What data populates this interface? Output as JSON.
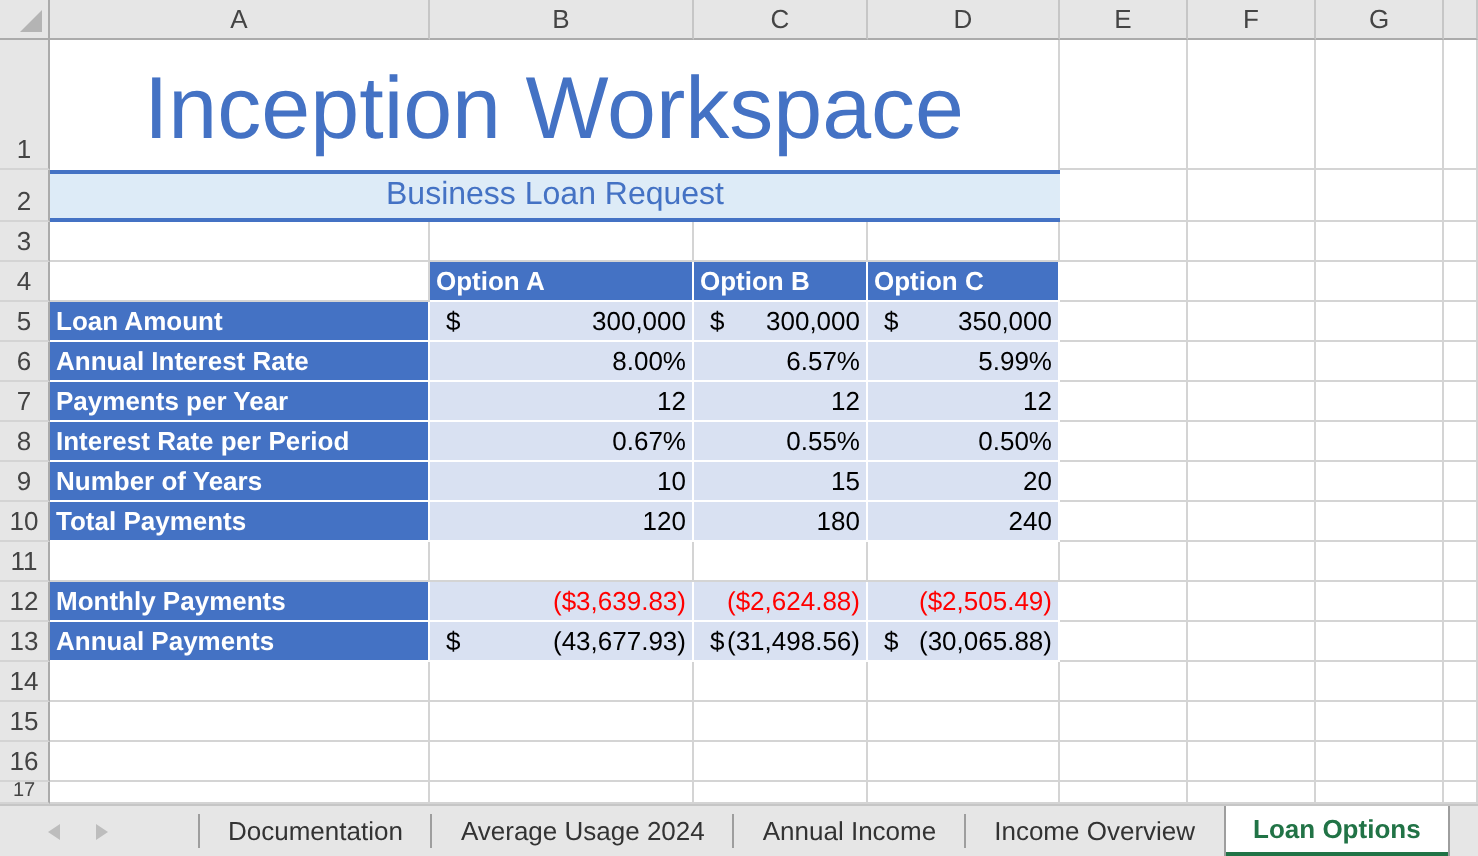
{
  "columns": [
    "A",
    "B",
    "C",
    "D",
    "E",
    "F",
    "G"
  ],
  "rows": [
    {
      "number": "1",
      "cells": [
        {
          "kind": "title",
          "text": "Inception Workspace"
        }
      ]
    },
    {
      "number": "2",
      "cells": [
        {
          "kind": "subtitle",
          "text": "Business Loan Request"
        }
      ]
    },
    {
      "number": "3",
      "cells": []
    },
    {
      "number": "4",
      "cells": [
        {
          "kind": "empty"
        },
        {
          "kind": "header",
          "text": "Option A"
        },
        {
          "kind": "header",
          "text": "Option B"
        },
        {
          "kind": "header",
          "text": "Option C"
        }
      ]
    },
    {
      "number": "5",
      "cells": [
        {
          "kind": "label",
          "text": "Loan Amount"
        },
        {
          "kind": "value",
          "symbol": "$",
          "text": "300,000",
          "red": false
        },
        {
          "kind": "value",
          "symbol": "$",
          "text": "300,000",
          "red": false
        },
        {
          "kind": "value",
          "symbol": "$",
          "text": "350,000",
          "red": false
        }
      ]
    },
    {
      "number": "6",
      "cells": [
        {
          "kind": "label",
          "text": "Annual Interest Rate"
        },
        {
          "kind": "value",
          "text": "8.00%",
          "red": false
        },
        {
          "kind": "value",
          "text": "6.57%",
          "red": false
        },
        {
          "kind": "value",
          "text": "5.99%",
          "red": false
        }
      ]
    },
    {
      "number": "7",
      "cells": [
        {
          "kind": "label",
          "text": "Payments per Year"
        },
        {
          "kind": "value",
          "text": "12",
          "red": false
        },
        {
          "kind": "value",
          "text": "12",
          "red": false
        },
        {
          "kind": "value",
          "text": "12",
          "red": false
        }
      ]
    },
    {
      "number": "8",
      "cells": [
        {
          "kind": "label",
          "text": "Interest Rate per Period"
        },
        {
          "kind": "value",
          "text": "0.67%",
          "red": false
        },
        {
          "kind": "value",
          "text": "0.55%",
          "red": false
        },
        {
          "kind": "value",
          "text": "0.50%",
          "red": false
        }
      ]
    },
    {
      "number": "9",
      "cells": [
        {
          "kind": "label",
          "text": "Number of Years"
        },
        {
          "kind": "value",
          "text": "10",
          "red": false
        },
        {
          "kind": "value",
          "text": "15",
          "red": false
        },
        {
          "kind": "value",
          "text": "20",
          "red": false
        }
      ]
    },
    {
      "number": "10",
      "cells": [
        {
          "kind": "label",
          "text": "Total Payments"
        },
        {
          "kind": "value",
          "text": "120",
          "red": false
        },
        {
          "kind": "value",
          "text": "180",
          "red": false
        },
        {
          "kind": "value",
          "text": "240",
          "red": false
        }
      ]
    },
    {
      "number": "11",
      "cells": []
    },
    {
      "number": "12",
      "cells": [
        {
          "kind": "label",
          "text": "Monthly Payments"
        },
        {
          "kind": "value",
          "text": "($3,639.83)",
          "red": true
        },
        {
          "kind": "value",
          "text": "($2,624.88)",
          "red": true
        },
        {
          "kind": "value",
          "text": "($2,505.49)",
          "red": true
        }
      ]
    },
    {
      "number": "13",
      "cells": [
        {
          "kind": "label",
          "text": "Annual Payments"
        },
        {
          "kind": "value",
          "symbol": "$",
          "text": "(43,677.93)",
          "red": false
        },
        {
          "kind": "value",
          "symbol": "$",
          "text": "(31,498.56)",
          "red": false
        },
        {
          "kind": "value",
          "symbol": "$",
          "text": "(30,065.88)",
          "red": false
        }
      ]
    },
    {
      "number": "14",
      "cells": []
    },
    {
      "number": "15",
      "cells": []
    },
    {
      "number": "16",
      "cells": []
    },
    {
      "number": "17",
      "cells": []
    }
  ],
  "sheet_tabs": [
    {
      "label": "Documentation",
      "selected": false
    },
    {
      "label": "Average Usage 2024",
      "selected": false
    },
    {
      "label": "Annual Income",
      "selected": false
    },
    {
      "label": "Income Overview",
      "selected": false
    },
    {
      "label": "Loan Options",
      "selected": true
    }
  ]
}
